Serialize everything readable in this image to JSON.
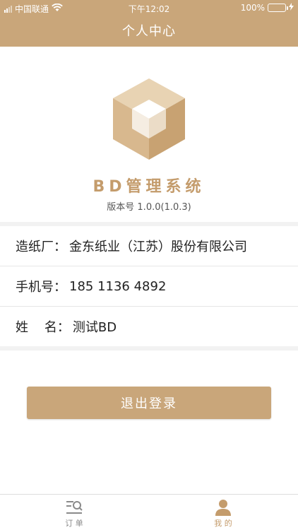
{
  "status_bar": {
    "carrier": "中国联通",
    "time": "下午12:02",
    "battery_percent": "100%",
    "battery_level": 1.0
  },
  "nav": {
    "title": "个人中心"
  },
  "app": {
    "name": "BD管理系统",
    "version": "版本号 1.0.0(1.0.3)"
  },
  "info": [
    {
      "label": "造纸厂：",
      "value": "金东纸业（江苏）股份有限公司"
    },
    {
      "label": "手机号：",
      "value": "185 1136 4892"
    },
    {
      "label": "姓    名：",
      "value": "测试BD"
    }
  ],
  "logout_label": "退出登录",
  "tabs": [
    {
      "label": "订 单",
      "icon": "order-list-icon"
    },
    {
      "label": "我 的",
      "icon": "person-icon"
    }
  ],
  "colors": {
    "accent": "#c9a67a",
    "accent_text": "#c49c6c",
    "battery": "#4cd964"
  }
}
